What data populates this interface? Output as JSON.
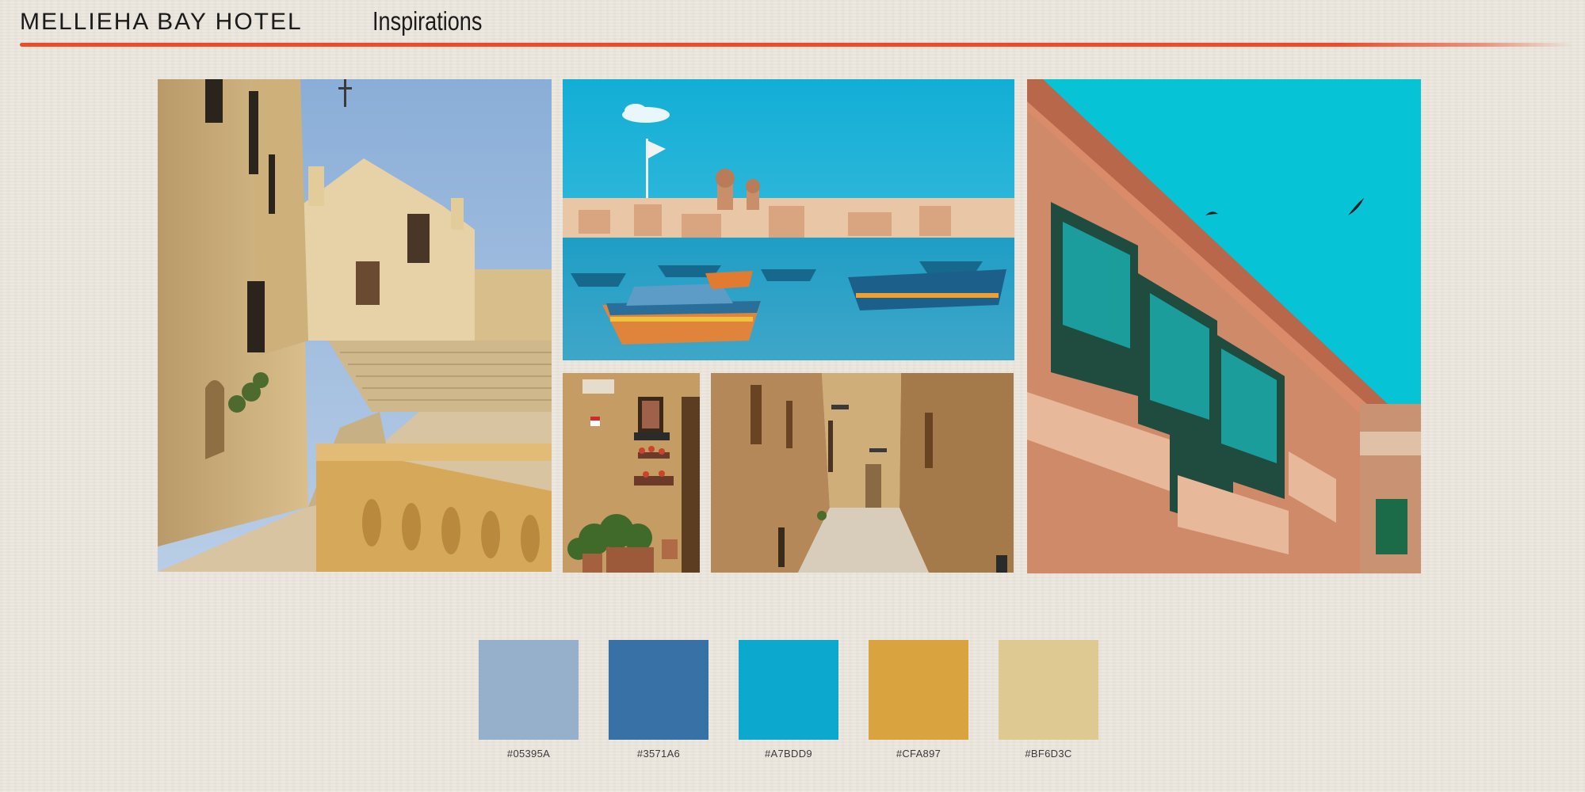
{
  "header": {
    "brand": "MELLIEHA BAY HOTEL",
    "title": "Inspirations",
    "accent_color": "#EE4B2A"
  },
  "palette": [
    {
      "label": "#05395A",
      "color": "#96B0CB"
    },
    {
      "label": "#3571A6",
      "color": "#3771A6"
    },
    {
      "label": "#A7BDD9",
      "color": "#0DA8CE"
    },
    {
      "label": "#CFA897",
      "color": "#D9A440"
    },
    {
      "label": "#BF6D3C",
      "color": "#DEC992"
    }
  ]
}
